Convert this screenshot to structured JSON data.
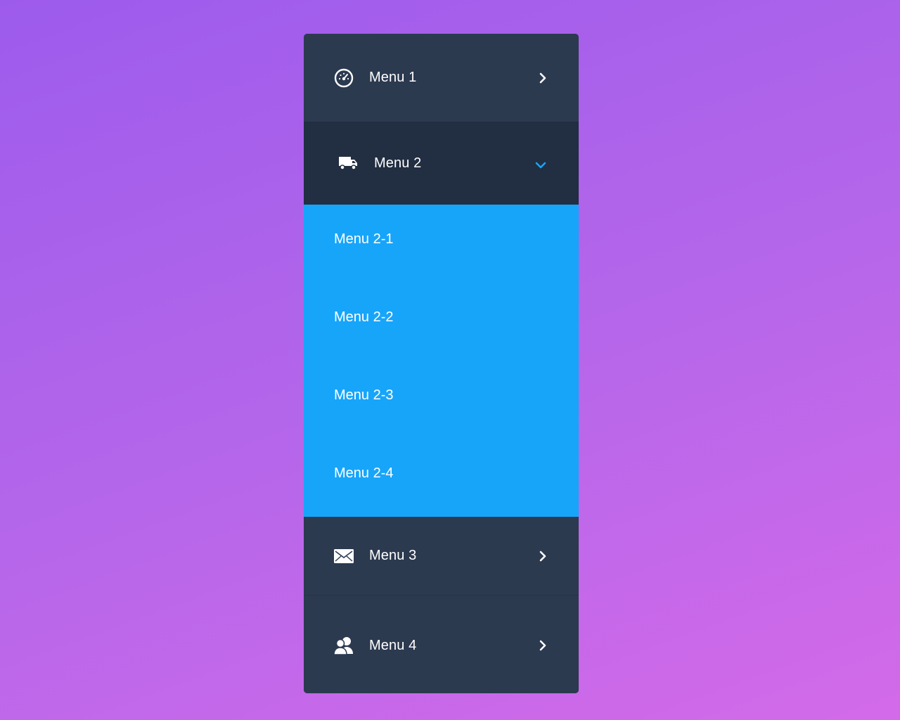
{
  "menu": {
    "items": [
      {
        "label": "Menu 1",
        "icon": "speedometer-icon",
        "chevron": "chevron-right-icon"
      },
      {
        "label": "Menu 2",
        "icon": "truck-icon",
        "chevron": "chevron-down-icon",
        "expanded": true,
        "subitems": [
          {
            "label": "Menu 2-1"
          },
          {
            "label": "Menu 2-2"
          },
          {
            "label": "Menu 2-3"
          },
          {
            "label": "Menu 2-4"
          }
        ]
      },
      {
        "label": "Menu 3",
        "icon": "envelope-icon",
        "chevron": "chevron-right-icon"
      },
      {
        "label": "Menu 4",
        "icon": "users-icon",
        "chevron": "chevron-right-icon"
      }
    ]
  },
  "colors": {
    "panel": "#2c3a50",
    "panel_active": "#222e41",
    "submenu": "#17a5fa",
    "accent": "#17a5fa",
    "text": "#ffffff"
  }
}
